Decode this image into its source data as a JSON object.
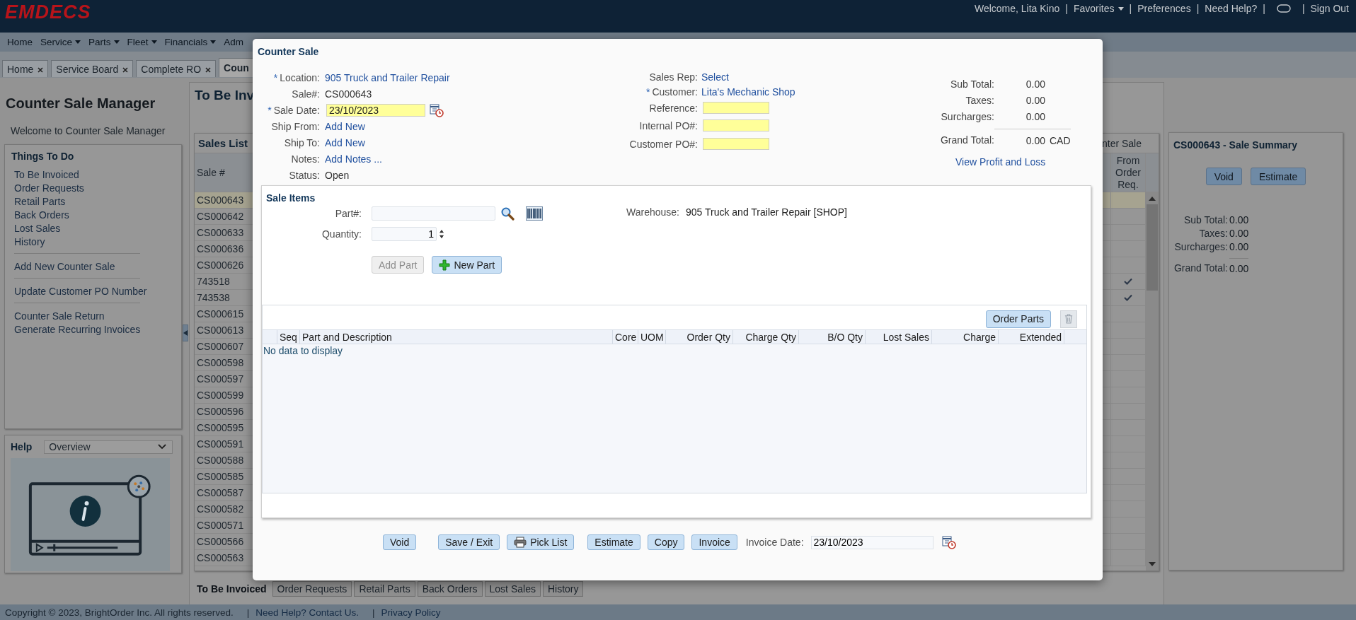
{
  "header": {
    "logo": "EMDECS",
    "items": [
      {
        "kind": "text",
        "text": "Welcome, Lita Kino"
      },
      {
        "kind": "separator",
        "text": "|"
      },
      {
        "kind": "menu",
        "text": "Favorites"
      },
      {
        "kind": "separator",
        "text": "|"
      },
      {
        "kind": "link",
        "text": "Preferences"
      },
      {
        "kind": "separator",
        "text": "|"
      },
      {
        "kind": "link",
        "text": "Need Help?"
      },
      {
        "kind": "separator",
        "text": "|"
      },
      {
        "kind": "icon"
      },
      {
        "kind": "separator",
        "text": "|"
      },
      {
        "kind": "link",
        "text": "Sign Out"
      }
    ]
  },
  "menu": [
    {
      "label": "Home",
      "dropdown": false
    },
    {
      "label": "Service",
      "dropdown": true
    },
    {
      "label": "Parts",
      "dropdown": true
    },
    {
      "label": "Fleet",
      "dropdown": true
    },
    {
      "label": "Financials",
      "dropdown": true
    },
    {
      "label": "Adm",
      "dropdown": false
    }
  ],
  "tabs": [
    {
      "label": "Home",
      "closable": true,
      "selected": false
    },
    {
      "label": "Service Board",
      "closable": true,
      "selected": false
    },
    {
      "label": "Complete RO",
      "closable": true,
      "selected": false
    },
    {
      "label": "Coun",
      "closable": false,
      "selected": true
    }
  ],
  "left_panel": {
    "title": "Counter Sale Manager",
    "welcome": "Welcome to Counter Sale Manager",
    "things_to_do": {
      "title": "Things To Do",
      "groups": [
        [
          "To Be Invoiced",
          "Order Requests",
          "Retail Parts",
          "Back Orders",
          "Lost Sales",
          "History"
        ],
        [
          "Add New Counter Sale"
        ],
        [
          "Update Customer PO Number"
        ],
        [
          "Counter Sale Return",
          "Generate Recurring Invoices"
        ]
      ]
    },
    "help": {
      "title": "Help",
      "select": "Overview"
    }
  },
  "center": {
    "title": "To Be Inv",
    "sales_list": {
      "title": "Sales List",
      "title_tail": "nter Sale",
      "columns": [
        "Sale #",
        "From Order Req."
      ],
      "rows": [
        {
          "sale": "CS000643",
          "from_order_req": false,
          "selected": true
        },
        {
          "sale": "CS000642",
          "from_order_req": false,
          "selected": false
        },
        {
          "sale": "CS000633",
          "from_order_req": false,
          "selected": false
        },
        {
          "sale": "CS000636",
          "from_order_req": false,
          "selected": false
        },
        {
          "sale": "CS000626",
          "from_order_req": false,
          "selected": false
        },
        {
          "sale": "743518",
          "from_order_req": true,
          "selected": false
        },
        {
          "sale": "743538",
          "from_order_req": true,
          "selected": false
        },
        {
          "sale": "CS000615",
          "from_order_req": false,
          "selected": false
        },
        {
          "sale": "CS000613",
          "from_order_req": false,
          "selected": false
        },
        {
          "sale": "CS000607",
          "from_order_req": false,
          "selected": false
        },
        {
          "sale": "CS000598",
          "from_order_req": false,
          "selected": false
        },
        {
          "sale": "CS000597",
          "from_order_req": false,
          "selected": false
        },
        {
          "sale": "CS000599",
          "from_order_req": false,
          "selected": false
        },
        {
          "sale": "CS000596",
          "from_order_req": false,
          "selected": false
        },
        {
          "sale": "CS000595",
          "from_order_req": false,
          "selected": false
        },
        {
          "sale": "CS000591",
          "from_order_req": false,
          "selected": false
        },
        {
          "sale": "CS000588",
          "from_order_req": false,
          "selected": false
        },
        {
          "sale": "CS000585",
          "from_order_req": false,
          "selected": false
        },
        {
          "sale": "CS000587",
          "from_order_req": false,
          "selected": false
        },
        {
          "sale": "CS000582",
          "from_order_req": false,
          "selected": false
        },
        {
          "sale": "CS000571",
          "from_order_req": false,
          "selected": false
        },
        {
          "sale": "CS000566",
          "from_order_req": false,
          "selected": false
        },
        {
          "sale": "CS000563",
          "from_order_req": false,
          "selected": false
        }
      ]
    },
    "bottom_tabs": [
      {
        "label": "To Be Invoiced",
        "selected": true
      },
      {
        "label": "Order Requests",
        "selected": false
      },
      {
        "label": "Retail Parts",
        "selected": false
      },
      {
        "label": "Back Orders",
        "selected": false
      },
      {
        "label": "Lost Sales",
        "selected": false
      },
      {
        "label": "History",
        "selected": false
      }
    ]
  },
  "summary": {
    "title": "CS000643 - Sale Summary",
    "buttons": [
      "Void",
      "Estimate"
    ],
    "rows": [
      {
        "label": "Sub Total:",
        "value": "0.00",
        "total": false
      },
      {
        "label": "Taxes:",
        "value": "0.00",
        "total": false
      },
      {
        "label": "Surcharges:",
        "value": "0.00",
        "total": false
      },
      {
        "label": "Grand Total:",
        "value": "0.00",
        "total": true
      }
    ]
  },
  "modal": {
    "title": "Counter Sale",
    "left_fields": [
      {
        "label": "Location:",
        "marker": "*",
        "kind": "link",
        "value": "905 Truck and Trailer Repair"
      },
      {
        "label": "Sale#:",
        "kind": "text",
        "value": "CS000643"
      },
      {
        "label": "Sale Date:",
        "marker": "*",
        "kind": "date",
        "value": "23/10/2023"
      },
      {
        "label": "Ship From:",
        "kind": "link",
        "value": "Add New"
      },
      {
        "label": "Ship To:",
        "kind": "link",
        "value": "Add New"
      },
      {
        "label": "Notes:",
        "kind": "link",
        "value": "Add Notes ..."
      },
      {
        "label": "Status:",
        "kind": "text",
        "value": "Open"
      }
    ],
    "middle_fields": [
      {
        "label": "Sales Rep:",
        "kind": "link",
        "value": "Select"
      },
      {
        "label": "Customer:",
        "marker": "*",
        "kind": "link",
        "value": "Lita's Mechanic Shop"
      },
      {
        "label": "Reference:",
        "kind": "input"
      },
      {
        "label": "Internal PO#:",
        "kind": "input"
      },
      {
        "label": "Customer PO#:",
        "kind": "input"
      }
    ],
    "totals": [
      {
        "label": "Sub Total:",
        "kind": "text",
        "value": "0.00"
      },
      {
        "label": "Taxes:",
        "kind": "link",
        "value": "0.00"
      },
      {
        "label": "Surcharges:",
        "kind": "link",
        "value": "0.00"
      },
      {
        "label": "Grand Total:",
        "kind": "total",
        "value": "0.00",
        "currency": "CAD"
      }
    ],
    "profit_link": "View Profit and Loss",
    "sale_items": {
      "title": "Sale Items",
      "part_label": "Part#:",
      "quantity_label": "Quantity:",
      "quantity": "1",
      "warehouse_label": "Warehouse:",
      "warehouse": "905 Truck and Trailer Repair [SHOP]",
      "buttons": [
        {
          "label": "Add Part",
          "disabled": true
        },
        {
          "label": "New Part",
          "disabled": false
        }
      ],
      "order_parts": "Order Parts",
      "columns": [
        "Seq",
        "Part and Description",
        "Core",
        "UOM",
        "Order Qty",
        "Charge Qty",
        "B/O Qty",
        "Lost Sales",
        "Charge",
        "Extended"
      ],
      "empty_text": "No data to display"
    },
    "actions": [
      "Void",
      "Save / Exit",
      "Pick List",
      "Estimate",
      "Copy",
      "Invoice"
    ],
    "invoice_date_label": "Invoice Date:",
    "invoice_date": "23/10/2023"
  },
  "footer": {
    "items": [
      {
        "kind": "text",
        "text": "Copyright © 2023, BrightOrder Inc. All rights reserved."
      },
      {
        "kind": "separator",
        "text": "|"
      },
      {
        "kind": "link",
        "text": "Need Help? Contact Us."
      },
      {
        "kind": "separator",
        "text": "|"
      },
      {
        "kind": "link",
        "text": "Privacy Policy"
      }
    ]
  }
}
